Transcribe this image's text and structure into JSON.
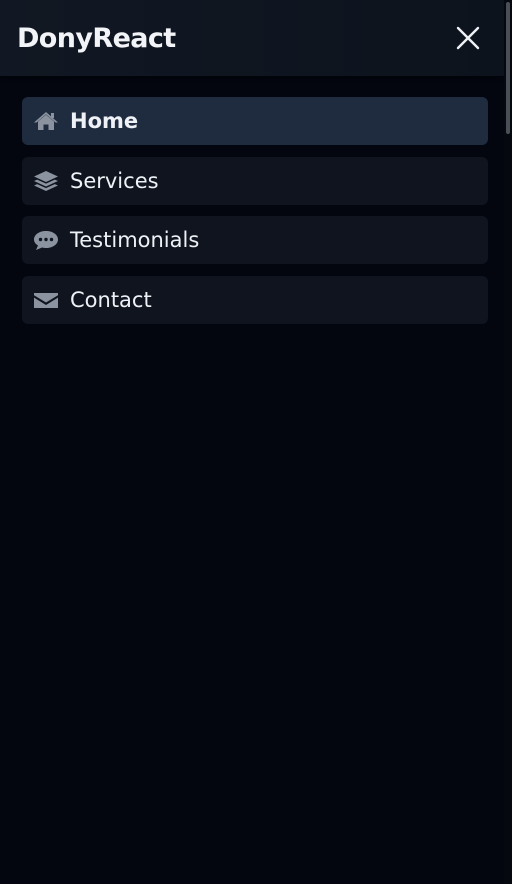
{
  "app": {
    "brand": "DonyReact"
  },
  "nav": {
    "items": [
      {
        "label": "Home",
        "icon": "home-icon",
        "active": true
      },
      {
        "label": "Services",
        "icon": "layers-icon",
        "active": false
      },
      {
        "label": "Testimonials",
        "icon": "chat-icon",
        "active": false
      },
      {
        "label": "Contact",
        "icon": "envelope-icon",
        "active": false
      }
    ]
  },
  "colors": {
    "background": "#03060f",
    "header": "#121823",
    "item": "#0f141e",
    "item_active": "#1f2c3f",
    "icon": "#8a939f",
    "text": "#eef1f5"
  }
}
